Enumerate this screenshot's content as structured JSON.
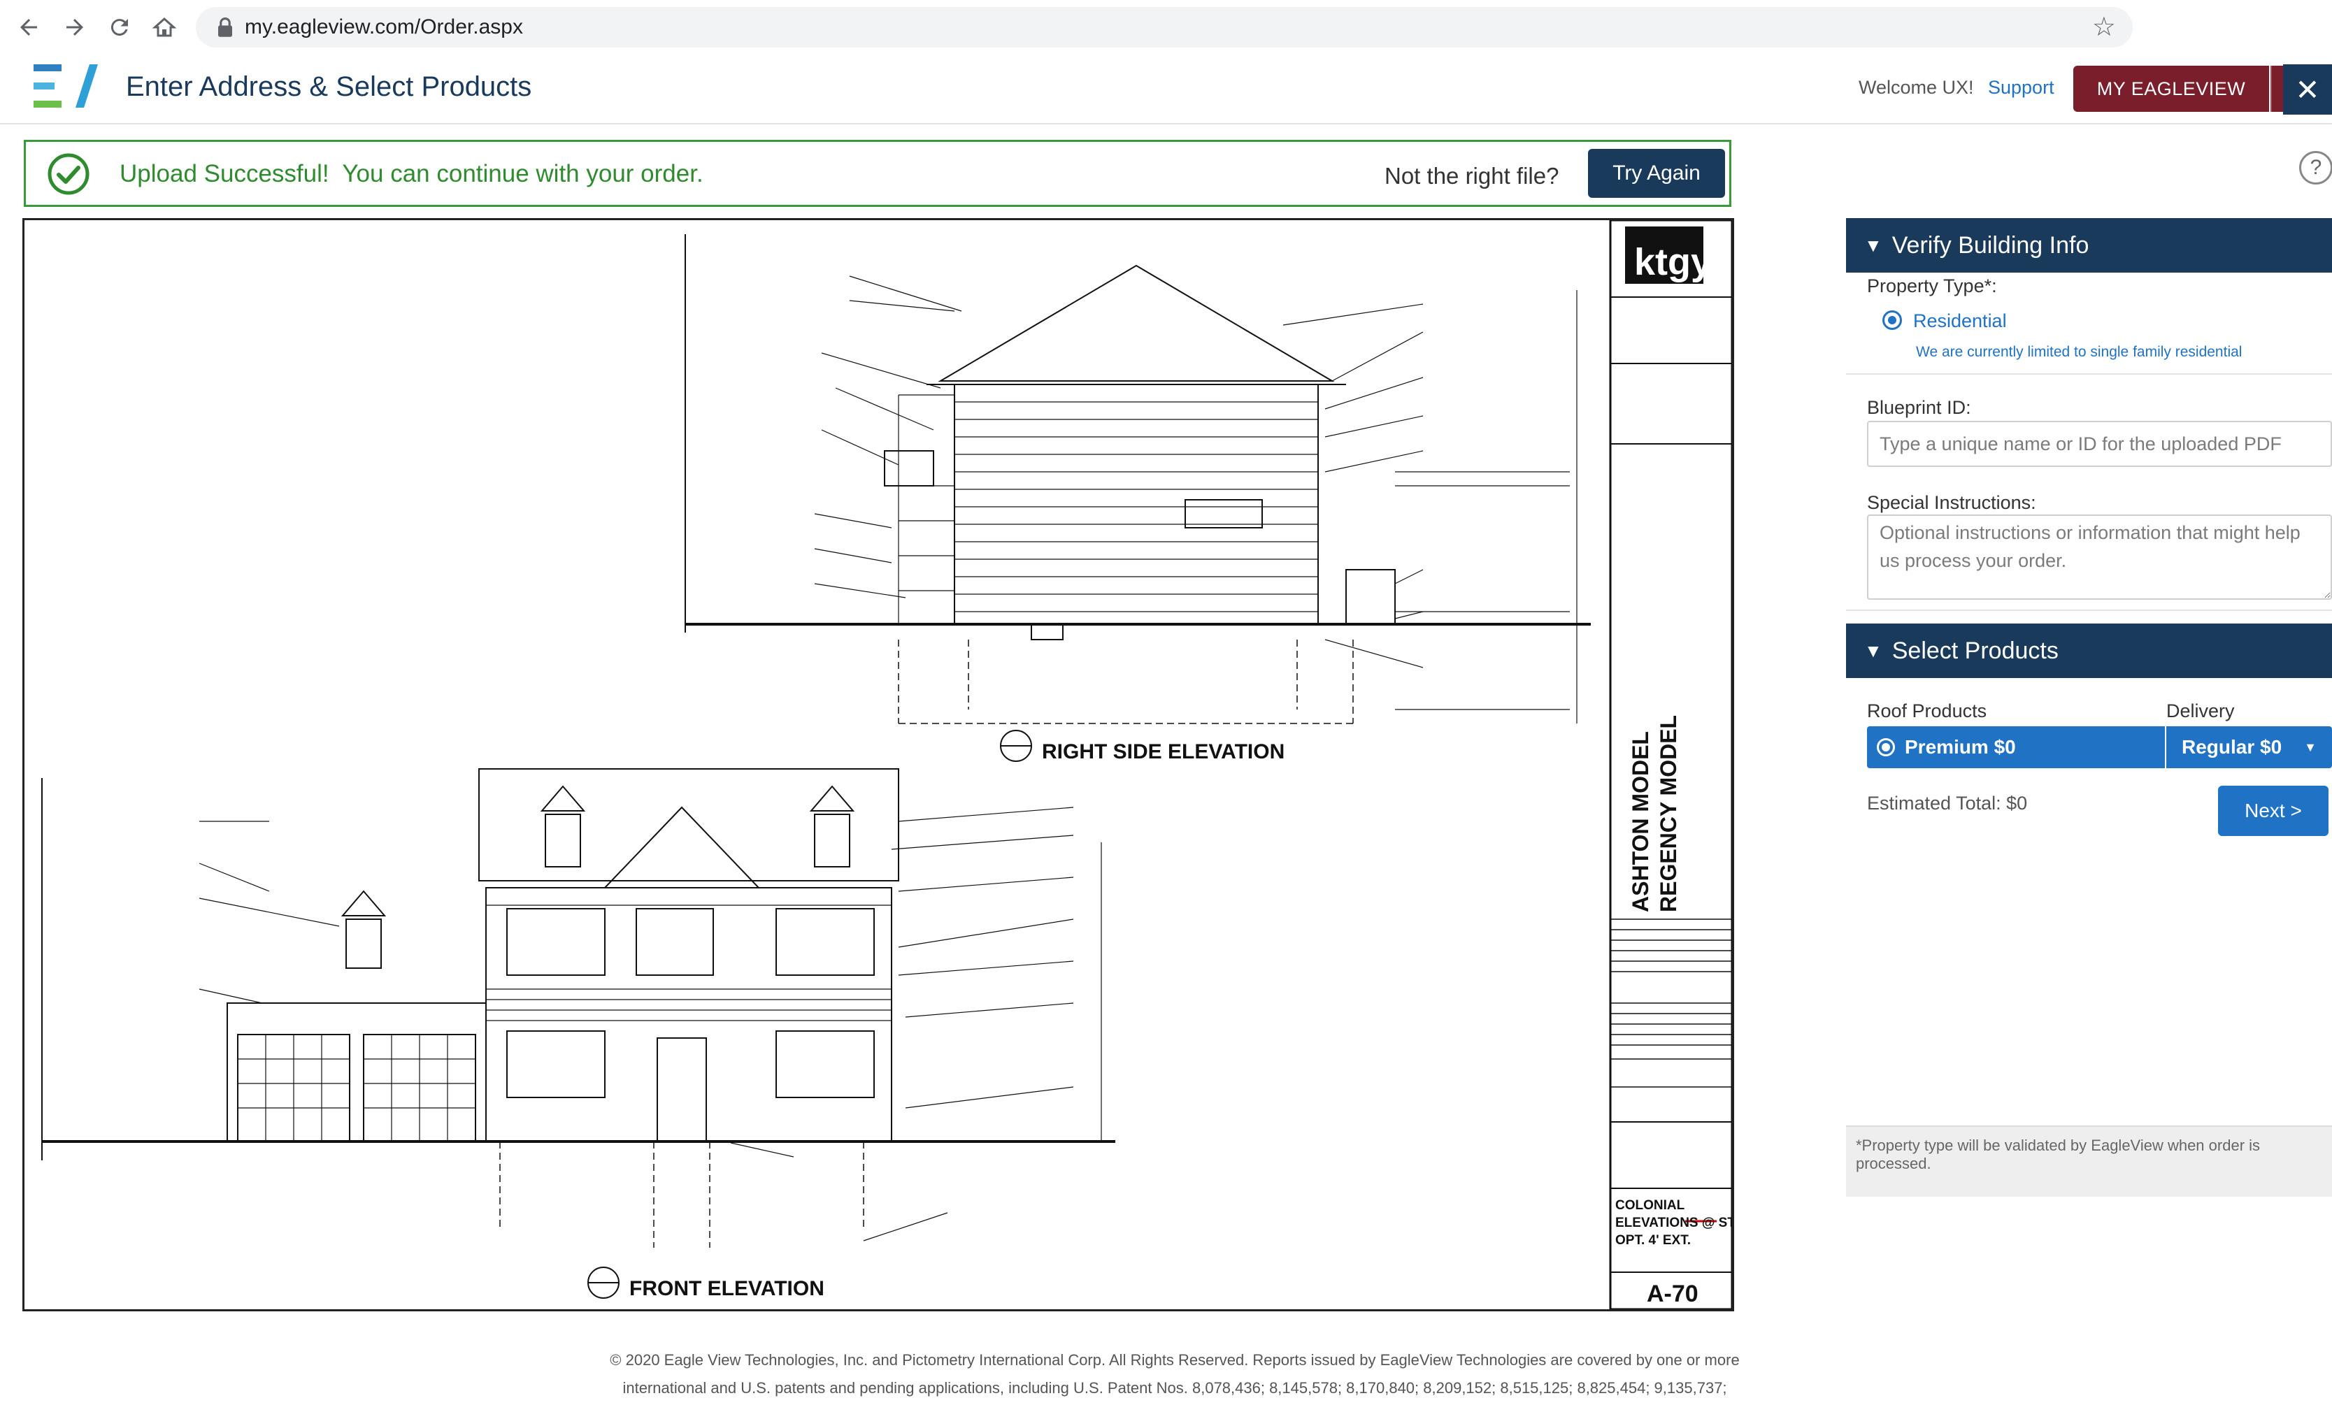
{
  "browser": {
    "url": "my.eagleview.com/Order.aspx"
  },
  "header": {
    "title": "Enter Address & Select Products",
    "welcome": "Welcome UX!",
    "support": "Support",
    "my_eagleview": "MY EAGLEVIEW"
  },
  "banner": {
    "message": "Upload Successful!  You can continue with your order.",
    "not_right": "Not the right file?",
    "try_again": "Try Again"
  },
  "blueprint": {
    "right_elevation": "RIGHT SIDE ELEVATION",
    "front_elevation": "FRONT ELEVATION",
    "model_1": "ASHTON MODEL",
    "model_2": "REGENCY MODEL",
    "sheet_line1": "COLONIAL",
    "sheet_line2": "ELEVATIONS @ STD",
    "sheet_line3": "OPT. 4' EXT.",
    "sheet_number": "A-70",
    "logo_text": "ktgy"
  },
  "verify": {
    "title": "Verify Building Info",
    "property_type_label": "Property Type*:",
    "residential": "Residential",
    "residential_note": "We are currently limited to single family residential",
    "blueprint_id_label": "Blueprint ID:",
    "blueprint_id_placeholder": "Type a unique name or ID for the uploaded PDF",
    "special_label": "Special Instructions:",
    "special_placeholder": "Optional instructions or information that might help us process your order."
  },
  "products": {
    "title": "Select Products",
    "roof_label": "Roof Products",
    "delivery_label": "Delivery",
    "premium": "Premium $0",
    "regular": "Regular $0",
    "estimated_total": "Estimated Total: $0",
    "next": "Next >"
  },
  "disclaimer": "*Property type will be validated by EagleView when order is processed.",
  "footer": {
    "line1": "© 2020 Eagle View Technologies, Inc. and Pictometry International Corp. All Rights Reserved. Reports issued by EagleView Technologies are covered by one or more",
    "line2": "international and U.S. patents and pending applications, including U.S. Patent Nos. 8,078,436; 8,145,578; 8,170,840; 8,209,152; 8,515,125; 8,825,454; 9,135,737;"
  },
  "colors": {
    "navy": "#1a3a5c",
    "maroon": "#7a1e2b",
    "blue": "#1f72c4",
    "success_green": "#2e8b2e"
  }
}
